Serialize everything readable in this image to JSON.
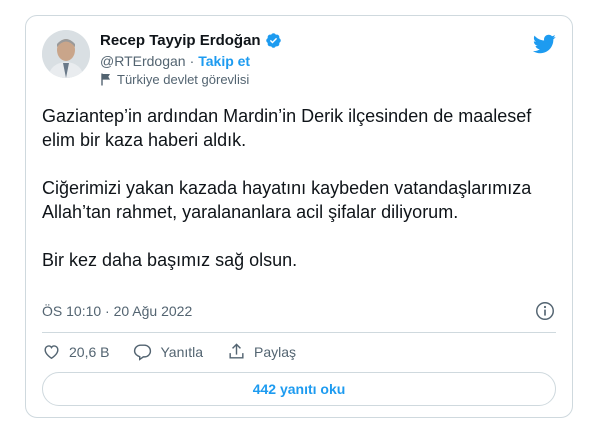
{
  "author": {
    "name": "Recep Tayyip Erdoğan",
    "handle": "@RTErdogan",
    "separator": "·",
    "follow_label": "Takip et",
    "account_label": "Türkiye devlet görevlisi"
  },
  "tweet": {
    "paragraphs": [
      "Gaziantep’in ardından Mardin’in Derik ilçesinden de maalesef elim bir kaza haberi aldık.",
      "Ciğerimizi yakan kazada hayatını kaybeden vatandaşlarımıza Allah’tan rahmet, yaralananlara acil şifalar diliyorum.",
      "Bir kez daha başımız sağ olsun."
    ],
    "timestamp": "ÖS 10:10 · 20 Ağu 2022"
  },
  "actions": {
    "likes": "20,6 B",
    "reply_label": "Yanıtla",
    "share_label": "Paylaş"
  },
  "read_replies_label": "442 yanıtı oku",
  "colors": {
    "accent": "#1d9bf0",
    "text": "#0f1419",
    "muted": "#536471",
    "border": "#cfd9de"
  },
  "icons": [
    "verified-badge-icon",
    "twitter-bird-icon",
    "flag-icon",
    "info-icon",
    "heart-icon",
    "reply-icon",
    "share-icon"
  ]
}
